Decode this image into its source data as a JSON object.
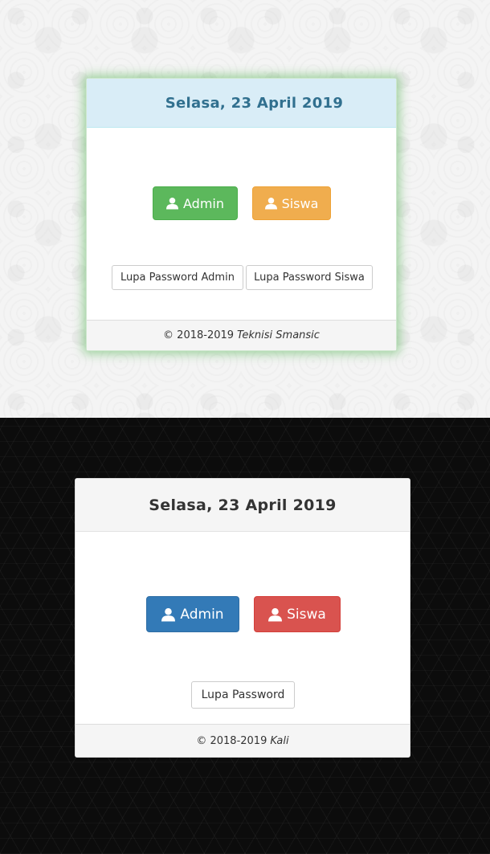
{
  "panel_light": {
    "title": "Selasa, 23 April 2019",
    "admin_button": "Admin",
    "siswa_button": "Siswa",
    "forgot_admin": "Lupa Password Admin",
    "forgot_siswa": "Lupa Password Siswa",
    "footer_copyright": "© 2018-2019",
    "footer_author": "Teknisi Smansic",
    "colors": {
      "header_bg": "#d9edf7",
      "title": "#31708f",
      "admin": "#5cb85c",
      "siswa": "#f0ad4e",
      "glow": "#5cb85c"
    },
    "icons": [
      "user-icon",
      "user-icon"
    ]
  },
  "panel_dark": {
    "title": "Selasa, 23 April 2019",
    "admin_button": "Admin",
    "siswa_button": "Siswa",
    "forgot_password": "Lupa Password",
    "footer_copyright": "© 2018-2019",
    "footer_author": "Kali",
    "colors": {
      "header_bg": "#f5f5f5",
      "title": "#333333",
      "admin": "#337ab7",
      "siswa": "#d9534f"
    },
    "icons": [
      "user-icon",
      "user-icon"
    ]
  }
}
